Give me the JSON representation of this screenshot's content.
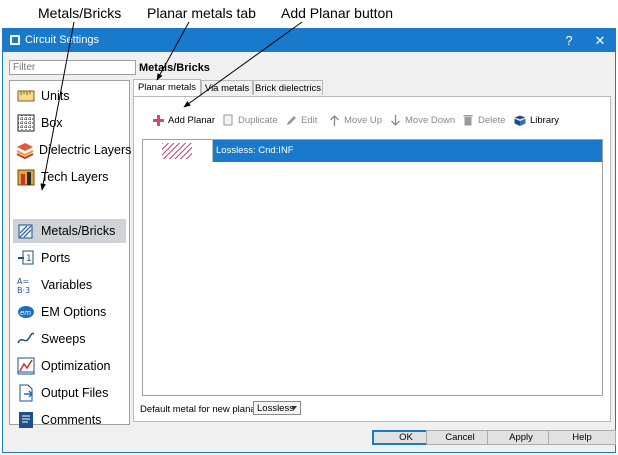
{
  "callouts": {
    "metals_bricks": "Metals/Bricks",
    "planar_metals_tab": "Planar metals tab",
    "add_planar_button": "Add Planar button"
  },
  "window": {
    "title": "Circuit Settings",
    "help_label": "?",
    "close_label": "✕"
  },
  "filter": {
    "placeholder": "Filter"
  },
  "nav": {
    "items": [
      {
        "label": "Units",
        "icon": "ruler-icon"
      },
      {
        "label": "Box",
        "icon": "grid-box-icon"
      },
      {
        "label": "Dielectric Layers",
        "icon": "layers-icon"
      },
      {
        "label": "Tech Layers",
        "icon": "tech-layers-icon"
      },
      {
        "label": "Metals/Bricks",
        "icon": "metal-icon"
      },
      {
        "label": "Ports",
        "icon": "ports-icon"
      },
      {
        "label": "Variables",
        "icon": "variables-icon"
      },
      {
        "label": "EM Options",
        "icon": "em-options-icon"
      },
      {
        "label": "Sweeps",
        "icon": "sweep-icon"
      },
      {
        "label": "Optimization",
        "icon": "optimization-icon"
      },
      {
        "label": "Output Files",
        "icon": "output-files-icon"
      },
      {
        "label": "Comments",
        "icon": "comments-icon"
      }
    ],
    "selected_index": 4
  },
  "panel": {
    "title": "Metals/Bricks",
    "tabs": [
      "Planar metals",
      "Via metals",
      "Brick dielectrics"
    ],
    "active_tab": 0
  },
  "toolbar": {
    "add_planar": "Add Planar",
    "duplicate": "Duplicate",
    "edit": "Edit",
    "move_up": "Move Up",
    "move_down": "Move Down",
    "delete": "Delete",
    "library": "Library"
  },
  "metals": [
    {
      "name": "Lossless: Cnd:INF",
      "selected": true,
      "pattern_color": "#c64e7d"
    }
  ],
  "default_metal": {
    "label": "Default metal for  new planar:",
    "value": "Lossless"
  },
  "buttons": {
    "ok": "OK",
    "cancel": "Cancel",
    "apply": "Apply",
    "help": "Help"
  },
  "colors": {
    "accent": "#1979ca",
    "selected_nav": "#cfd3d8",
    "add_icon": "#d94a6a"
  }
}
